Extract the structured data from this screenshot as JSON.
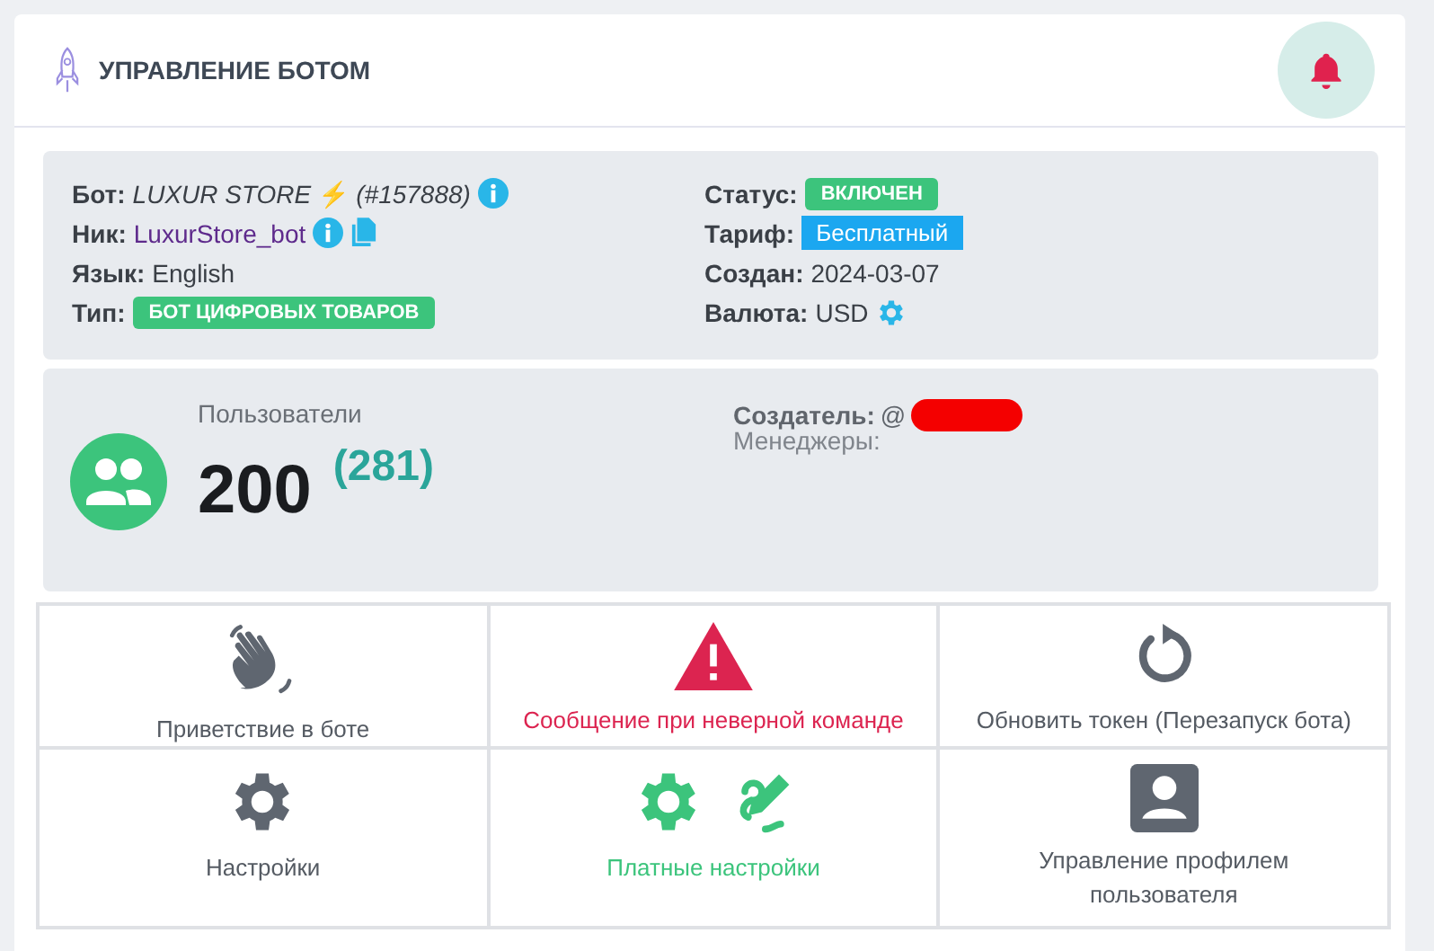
{
  "header": {
    "title": "УПРАВЛЕНИЕ БОТОМ"
  },
  "info_left": [
    {
      "kind": "bot",
      "label": "Бот:",
      "value": "LUXUR STORE",
      "bolt": "⚡",
      "id": "(#157888)"
    },
    {
      "kind": "nick",
      "label": "Ник:",
      "value": "LuxurStore_bot"
    },
    {
      "kind": "text",
      "label": "Язык:",
      "value": "English"
    },
    {
      "kind": "badge",
      "label": "Тип:",
      "value": "БОТ ЦИФРОВЫХ ТОВАРОВ",
      "color": "#3cc47c"
    }
  ],
  "info_right": [
    {
      "kind": "badge",
      "label": "Статус:",
      "value": "ВКЛЮЧЕН",
      "color": "#3cc47c"
    },
    {
      "kind": "plan",
      "label": "Тариф:",
      "value": "Бесплатный",
      "color": "#1ba7f0"
    },
    {
      "kind": "text",
      "label": "Создан:",
      "value": "2024-03-07"
    },
    {
      "kind": "currency",
      "label": "Валюта:",
      "value": "USD"
    }
  ],
  "users": {
    "label": "Пользователи",
    "count": "200",
    "total": "(281)"
  },
  "people": {
    "creator_label": "Создатель:",
    "creator_value": "@",
    "managers_label": "Менеджеры:"
  },
  "tiles": [
    {
      "kind": "wave",
      "label": "Приветствие в боте",
      "color": "#555b63"
    },
    {
      "kind": "warning",
      "label": "Сообщение при неверной команде",
      "color": "#dc2450"
    },
    {
      "kind": "refresh",
      "label": "Обновить токен (Перезапуск бота)",
      "color": "#555b63"
    },
    {
      "kind": "gear",
      "label": "Настройки",
      "color": "#555b63"
    },
    {
      "kind": "paid",
      "label": "Платные настройки",
      "color": "#3cc47c"
    },
    {
      "kind": "profile",
      "label": "Управление профилем пользователя",
      "color": "#555b63"
    }
  ]
}
